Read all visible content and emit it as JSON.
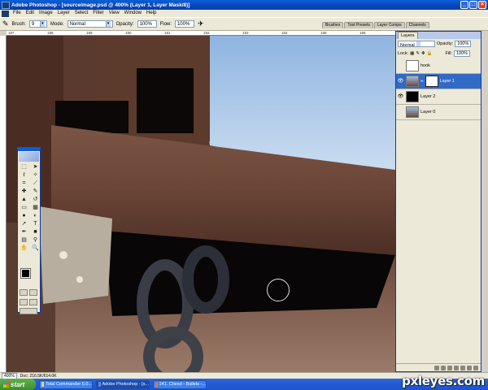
{
  "window": {
    "title": "Adobe Photoshop - [sourceimage.psd @ 400% (Layer 1, Layer Mask/8)]"
  },
  "menu": [
    "File",
    "Edit",
    "Image",
    "Layer",
    "Select",
    "Filter",
    "View",
    "Window",
    "Help"
  ],
  "options": {
    "brush_label": "Brush:",
    "brush_size": "9",
    "mode_label": "Mode:",
    "mode_value": "Normal",
    "opacity_label": "Opacity:",
    "opacity_value": "100%",
    "flow_label": "Flow:",
    "flow_value": "100%"
  },
  "palette_well": [
    "Brushes",
    "Tool Presets",
    "Layer Comps",
    "Channels"
  ],
  "ruler": {
    "top": [
      "187",
      "188",
      "189",
      "190",
      "191",
      "192",
      "193",
      "194",
      "195",
      "196"
    ]
  },
  "layers_panel": {
    "tab": "Layers",
    "blend_mode": "Normal",
    "opacity_label": "Opacity:",
    "opacity_value": "100%",
    "lock_label": "Lock:",
    "fill_label": "Fill:",
    "fill_value": "100%",
    "layers": [
      {
        "name": "hook",
        "visible": false,
        "selected": false
      },
      {
        "name": "Layer 1",
        "visible": true,
        "selected": true
      },
      {
        "name": "Layer 2",
        "visible": true,
        "selected": false
      },
      {
        "name": "Layer 0",
        "visible": false,
        "selected": false
      }
    ]
  },
  "status": {
    "zoom": "400%",
    "doc": "Doc: 216.5K/614.0K"
  },
  "taskbar": {
    "start": "start",
    "items": [
      {
        "label": "Total Commander 6.0..."
      },
      {
        "label": "Adobe Photoshop - [s..."
      },
      {
        "label": "141. Chesd - Bullets -..."
      }
    ]
  },
  "watermark": "pxleyes.com"
}
